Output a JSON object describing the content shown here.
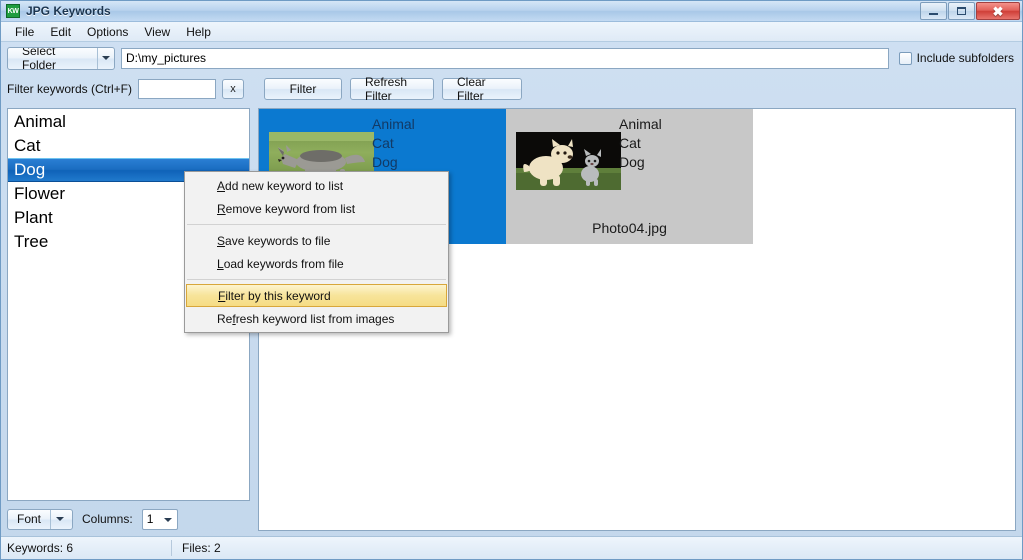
{
  "window": {
    "title": "JPG Keywords",
    "icon_label": "KW",
    "controls": {
      "minimize": "minimize-icon",
      "maximize": "maximize-icon",
      "close": "close-icon"
    }
  },
  "menubar": {
    "items": [
      {
        "label": "File"
      },
      {
        "label": "Edit"
      },
      {
        "label": "Options"
      },
      {
        "label": "View"
      },
      {
        "label": "Help"
      }
    ]
  },
  "toolbar": {
    "select_folder_label": "Select Folder",
    "path_value": "D:\\my_pictures",
    "include_subfolders_label": "Include subfolders",
    "include_subfolders_checked": false
  },
  "filterbar": {
    "keywords_filter_label": "Filter keywords (Ctrl+F)",
    "keywords_filter_value": "",
    "clear_small_label": "x",
    "filter_button": "Filter",
    "refresh_filter_button": "Refresh Filter",
    "clear_filter_button": "Clear Filter"
  },
  "keyword_list": {
    "items": [
      {
        "label": "Animal",
        "selected": false
      },
      {
        "label": "Cat",
        "selected": false
      },
      {
        "label": "Dog",
        "selected": true
      },
      {
        "label": "Flower",
        "selected": false
      },
      {
        "label": "Plant",
        "selected": false
      },
      {
        "label": "Tree",
        "selected": false
      }
    ]
  },
  "left_bottom": {
    "font_button": "Font",
    "columns_label": "Columns:",
    "columns_value": "1"
  },
  "thumbnails": [
    {
      "selected": true,
      "keywords": [
        "Animal",
        "Cat",
        "Dog"
      ],
      "filename": "",
      "image_alt": "wolf-in-grass-photo"
    },
    {
      "selected": false,
      "keywords": [
        "Animal",
        "Cat",
        "Dog"
      ],
      "filename": "Photo04.jpg",
      "image_alt": "puppy-and-kitten-photo"
    }
  ],
  "context_menu": {
    "items": [
      {
        "pre": "",
        "mn": "A",
        "post": "dd new keyword to list",
        "highlight": false
      },
      {
        "pre": "",
        "mn": "R",
        "post": "emove keyword from list",
        "highlight": false
      },
      {
        "separator": true
      },
      {
        "pre": "",
        "mn": "S",
        "post": "ave keywords to file",
        "highlight": false
      },
      {
        "pre": "",
        "mn": "L",
        "post": "oad keywords from file",
        "highlight": false
      },
      {
        "separator": true
      },
      {
        "pre": "",
        "mn": "F",
        "post": "ilter by this keyword",
        "highlight": true
      },
      {
        "pre": "Re",
        "mn": "f",
        "post": "resh keyword list from images",
        "highlight": false
      }
    ]
  },
  "statusbar": {
    "keywords_count": "Keywords: 6",
    "files_count": "Files: 2"
  },
  "colors": {
    "accent_blue": "#0b79d0",
    "selection_blue": "#1a6cc0",
    "highlight_gold": "#f7e49a",
    "thumb_gray": "#c8c8c8",
    "window_chrome": "#c3d7ec"
  }
}
